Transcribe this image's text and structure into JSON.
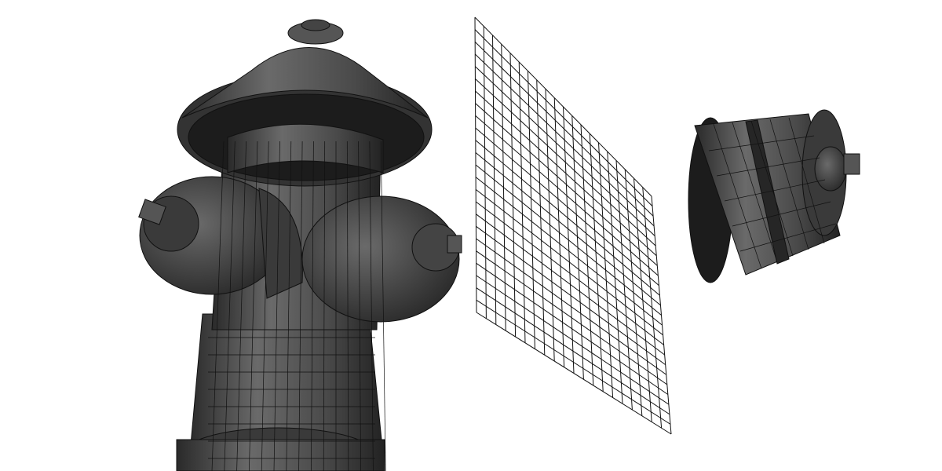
{
  "scene": {
    "background": "#ffffff",
    "model_color": "#4a4a4a",
    "model_dark": "#1c1c1c",
    "edge_color": "#111111",
    "grid": {
      "cols": 20,
      "rows": 24
    }
  }
}
